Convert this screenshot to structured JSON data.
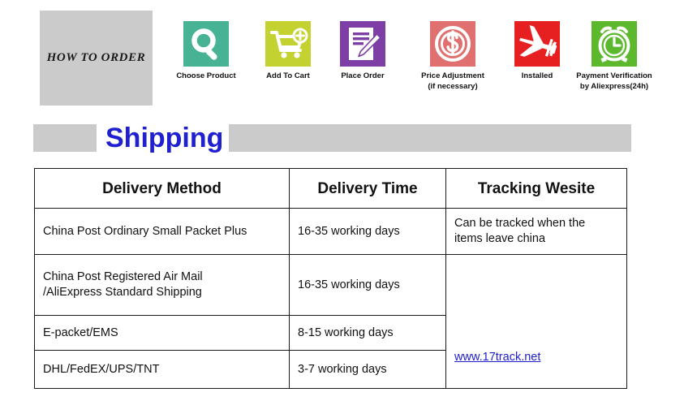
{
  "banner": {
    "title": "HOW  TO  ORDER",
    "panel_color": "#cbcbcb"
  },
  "steps": [
    {
      "icon": "search-icon",
      "label": "Choose Product",
      "label2": "",
      "color": "#48b394"
    },
    {
      "icon": "shopping-cart-icon",
      "label": "Add To Cart",
      "label2": "",
      "color": "#c3d231"
    },
    {
      "icon": "order-form-icon",
      "label": "Place Order",
      "label2": "",
      "color": "#7d3fa5"
    },
    {
      "icon": "dollar-coin-icon",
      "label": "Price  Adjustment",
      "label2": "(if necessary)",
      "color": "#e07070"
    },
    {
      "icon": "airplane-icon",
      "label": "Installed",
      "label2": "",
      "color": "#e62020"
    },
    {
      "icon": "alarm-clock-icon",
      "label": "Payment Verification",
      "label2": "by Aliexpress(24h)",
      "color": "#5cb82c"
    }
  ],
  "shipping": {
    "title": "Shipping",
    "title_color": "#2020d0",
    "band_color": "#cbcbcb"
  },
  "table": {
    "headers": [
      "Delivery Method",
      "Delivery Time",
      "Tracking Wesite"
    ],
    "rows": [
      {
        "method": "China Post Ordinary Small Packet Plus",
        "time": "16-35 working days",
        "tracking": "Can be tracked when the items leave china"
      },
      {
        "method": "China Post Registered Air Mail /AliExpress Standard Shipping",
        "method_line1": "China Post Registered Air Mail",
        "method_line2": "/AliExpress Standard Shipping",
        "time": "16-35 working days",
        "tracking": ""
      },
      {
        "method": "E-packet/EMS",
        "time": "8-15 working days",
        "tracking": ""
      },
      {
        "method": "DHL/FedEX/UPS/TNT",
        "time": "3-7 working days",
        "tracking": ""
      }
    ],
    "tracking_link": "www.17track.net",
    "tracking_note_line1": "Can be tracked when the",
    "tracking_note_line2": "items leave china",
    "link_color": "#2020d0",
    "border_color": "#1a1a1a"
  }
}
